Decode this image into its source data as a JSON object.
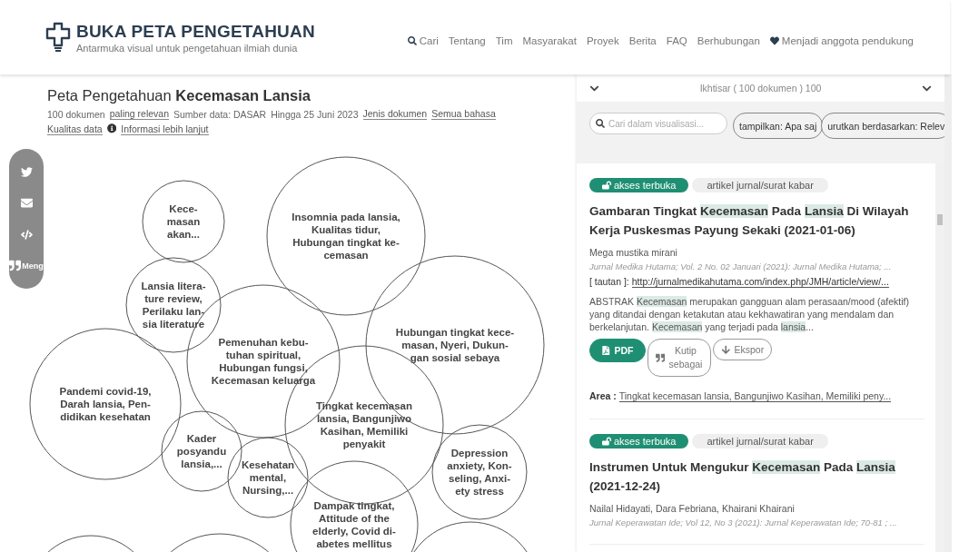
{
  "header": {
    "title": "BUKA PETA PENGETAHUAN",
    "subtitle": "Antarmuka visual untuk pengetahuan ilmiah dunia",
    "nav": [
      {
        "label": "Cari",
        "kind": "search"
      },
      {
        "label": "Tentang",
        "kind": "plain"
      },
      {
        "label": "Tim",
        "kind": "plain"
      },
      {
        "label": "Masyarakat",
        "kind": "plain"
      },
      {
        "label": "Proyek",
        "kind": "plain"
      },
      {
        "label": "Berita",
        "kind": "plain"
      },
      {
        "label": "FAQ",
        "kind": "plain"
      },
      {
        "label": "Berhubungan",
        "kind": "plain"
      },
      {
        "label": "Menjadi anggota pendukung",
        "kind": "support"
      }
    ]
  },
  "map": {
    "title_prefix": "Peta Pengetahuan",
    "title_topic": "Kecemasan Lansia",
    "meta": [
      {
        "text": "100 dokumen"
      },
      {
        "text": "paling relevan",
        "link": true
      },
      {
        "text": "Sumber data: DASAR"
      },
      {
        "text": "Hingga 25 Juni 2023"
      },
      {
        "text": "Jenis dokumen",
        "link": true
      },
      {
        "text": "Semua bahasa",
        "link": true
      }
    ],
    "meta2": [
      {
        "text": "Kualitas data",
        "link": true,
        "kind": "plain"
      },
      {
        "text": "Informasi lebih lanjut",
        "link": true,
        "kind": "info"
      }
    ],
    "share": [
      {
        "kind": "twitter"
      },
      {
        "kind": "mail"
      },
      {
        "kind": "embed"
      },
      {
        "kind": "cite",
        "label": "Meng"
      }
    ],
    "bubbles": [
      {
        "lines": [
          "Kece-",
          "masan",
          "akan..."
        ]
      },
      {
        "lines": [
          "Insomnia pada lansia,",
          "Kualitas tidur,",
          "Hubungan tingkat ke-",
          "cemasan"
        ]
      },
      {
        "lines": [
          "Lansia litera-",
          "ture review,",
          "Perilaku lan-",
          "sia literature"
        ]
      },
      {
        "lines": [
          "Pemenuhan kebu-",
          "tuhan spiritual,",
          "Hubungan fungsi,",
          "Kecemasan keluarga"
        ]
      },
      {
        "lines": [
          "Hubungan tingkat kece-",
          "masan, Nyeri, Dukun-",
          "gan sosial sebaya"
        ]
      },
      {
        "lines": [
          "Pandemi covid-19,",
          "Darah lansia, Pen-",
          "didikan kesehatan"
        ]
      },
      {
        "lines": [
          "Tingkat kecemasan",
          "lansia, Bangunjiwo",
          "Kasihan, Memiliki",
          "penyakit"
        ]
      },
      {
        "lines": [
          "Kader",
          "posyandu",
          "lansia,..."
        ]
      },
      {
        "lines": [
          "Kesehatan",
          "mental,",
          "Nursing,..."
        ]
      },
      {
        "lines": [
          "Depression",
          "anxiety, Kon-",
          "seling, Anxi-",
          "ety stress"
        ]
      },
      {
        "lines": [
          "Dampak tingkat,",
          "Attitude of the",
          "elderly, Covid di-",
          "abetes mellitus"
        ]
      }
    ]
  },
  "panel": {
    "overview": "Ikhtisar ( 100 dokumen ) 100",
    "search": {
      "placeholder": "Cari dalam visualisasi..."
    },
    "filters": [
      "tampilkan: Apa saj",
      "urutkan berdasarkan: Relev"
    ],
    "documents": [
      {
        "access": "akses terbuka",
        "type": "artikel jurnal/surat kabar",
        "title": [
          {
            "text": "Gambaran Tingkat "
          },
          {
            "text": "Kecemasan",
            "highlighted": true
          },
          {
            "text": " Pada "
          },
          {
            "text": "Lansia",
            "highlighted": true
          },
          {
            "text": " Di Wilayah Kerja Puskesmas Payung Sekaki (2021-01-06)"
          }
        ],
        "authors": "Mega mustika mirani",
        "source": "Jurnal Medika Hutama; Vol. 2 No. 02 Januari (2021): Jurnal Medika Hutama; ...",
        "link_label": "[ tautan ]:",
        "link": "http://jurnalmedikahutama.com/index.php/JMH/article/view/...",
        "abstract": [
          {
            "text": "ABSTRAK "
          },
          {
            "text": "Kecemasan",
            "highlighted": true
          },
          {
            "text": " merupakan gangguan alam perasaan/mood (afektif) yang ditandai dengan ketakutan atau kekhawatiran yang mendalam dan berkelanjutan. "
          },
          {
            "text": "Kecemasan",
            "highlighted": true
          },
          {
            "text": " yang terjadi pada "
          },
          {
            "text": "lansia",
            "highlighted": true
          },
          {
            "text": "..."
          }
        ],
        "actions": [
          {
            "kind": "pdf",
            "label": "PDF"
          },
          {
            "kind": "cite",
            "label": "Kutip sebagai"
          },
          {
            "kind": "export",
            "label": "Ekspor"
          }
        ],
        "area_label": "Area :",
        "area": "Tingkat kecemasan lansia, Bangunjiwo Kasihan, Memiliki peny..."
      },
      {
        "access": "akses terbuka",
        "type": "artikel jurnal/surat kabar",
        "title": [
          {
            "text": "Instrumen Untuk Mengukur "
          },
          {
            "text": "Kecemasan",
            "highlighted": true
          },
          {
            "text": " Pada "
          },
          {
            "text": "Lansia",
            "highlighted": true
          },
          {
            "text": " (2021-12-24)"
          }
        ],
        "authors": "Nailal Hidayati, Dara Febriana, Khairani Khairani",
        "source": "Jurnal Keperawatan Ide; Vol 12, No 3 (2021): Jurnal Keperawatan Ide; 70-81 ; ..."
      }
    ]
  }
}
